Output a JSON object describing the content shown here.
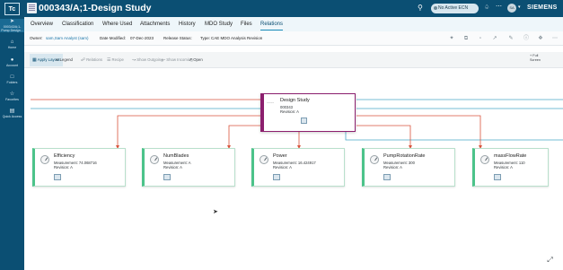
{
  "rail": {
    "logo": "Tc",
    "items": [
      {
        "icon": "go-to-icon",
        "label": "000343/A;1-Pump Design..."
      },
      {
        "icon": "home-icon",
        "label": "Home"
      },
      {
        "icon": "account-icon",
        "label": "Account"
      },
      {
        "icon": "folders-icon",
        "label": "Folders"
      },
      {
        "icon": "favorites-icon",
        "label": "Favorites"
      },
      {
        "icon": "quick-access-icon",
        "label": "Quick Access"
      }
    ]
  },
  "header": {
    "title": "000343/A;1-Design Study",
    "ecn": "No Active ECN",
    "avatar": "SA",
    "brand": "SIEMENS"
  },
  "tabs": [
    "Overview",
    "Classification",
    "Where Used",
    "Attachments",
    "History",
    "MDO Study",
    "Files",
    "Relations"
  ],
  "active_tab": "Relations",
  "info": {
    "owner_label": "Owner:",
    "owner_value": "sam,Sam Analyst (sam)",
    "modified_label": "Date Modified:",
    "modified_value": "07-Dec-2023",
    "release_label": "Release Status:",
    "type_label": "Type:",
    "type_value": "CAE MDO Analysis Revision"
  },
  "toolbar": {
    "apply_layout": "Apply Layout",
    "legend": "Legend",
    "relations": "Relations",
    "recipe": "Recipe",
    "show_outgoing": "Show Outgoing",
    "show_incoming": "Show Incoming",
    "open": "Open",
    "full": "+ Full",
    "screen": "Screen"
  },
  "study": {
    "name": "Design Study",
    "id": "000343",
    "revision": "Revision: A",
    "thumb": "~~~~"
  },
  "nodes": [
    {
      "name": "Efficiency",
      "measurement": "Measurement: 74.068716",
      "revision": "Revision: A"
    },
    {
      "name": "NumBlades",
      "measurement": "Measurement: A",
      "revision": "Revision: A"
    },
    {
      "name": "Power",
      "measurement": "Measurement: 16.424917",
      "revision": "Revision: A"
    },
    {
      "name": "PumpRotationRate",
      "measurement": "Measurement: 300",
      "revision": "Revision: A"
    },
    {
      "name": "massFlowRate",
      "measurement": "Measurement: 110",
      "revision": "Revision: A"
    }
  ],
  "colors": {
    "header": "#0b4f73",
    "link_red": "#d9533c",
    "link_blue": "#4aa7c9",
    "study_border": "#8c1f6e",
    "node_accent": "#4cc38a"
  }
}
